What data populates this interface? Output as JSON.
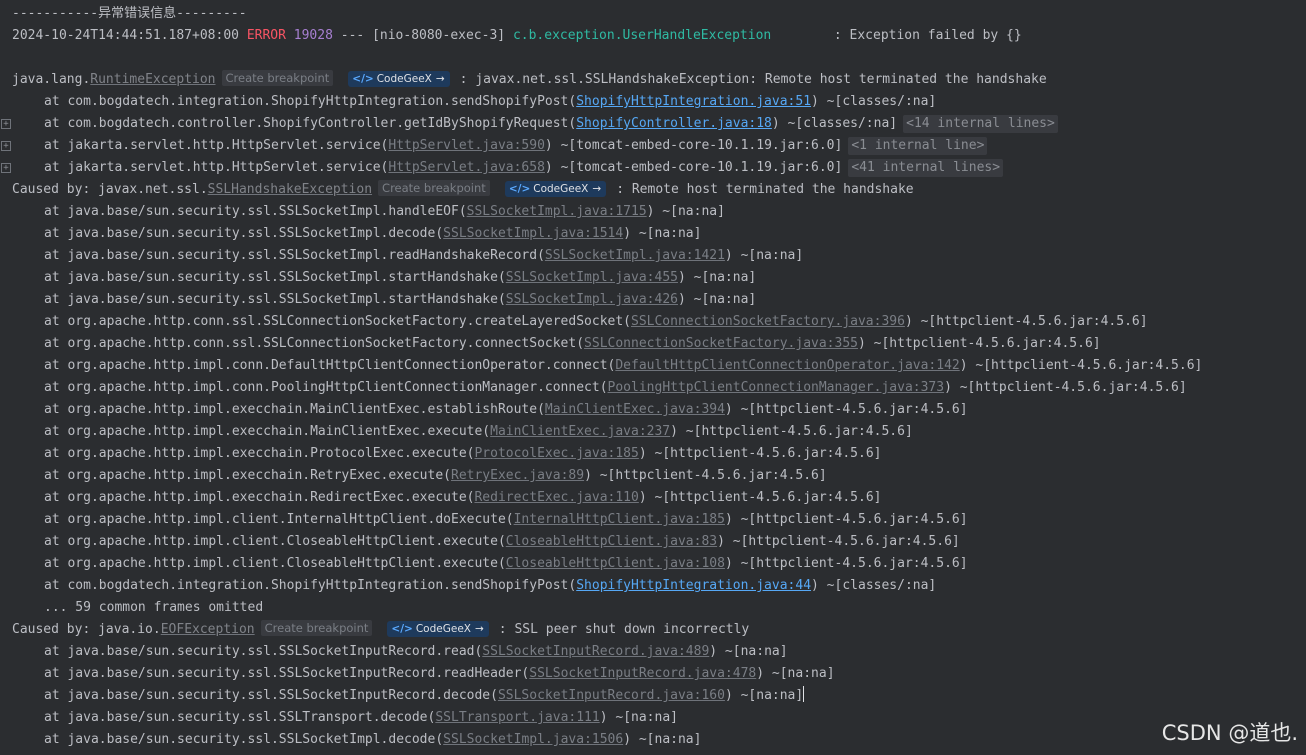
{
  "header_line": "-----------异常错误信息---------",
  "log_line": {
    "timestamp": "2024-10-24T14:44:51.187+08:00",
    "level": "ERROR",
    "pid": "19028",
    "sep": "---",
    "thread": "[nio-8080-exec-3]",
    "logger": "c.b.exception.UserHandleException",
    "message": ": Exception failed by {}"
  },
  "badges": {
    "create_breakpoint": "Create breakpoint",
    "codegeex": "CodeGeeX",
    "codegeex_icon": "</>",
    "codegeex_arrow": "→"
  },
  "exceptions": [
    {
      "prefix": "java.lang.",
      "name": "RuntimeException",
      "message": ": javax.net.ssl.SSLHandshakeException: Remote host terminated the handshake",
      "frames": [
        {
          "method": "at com.bogdatech.integration.ShopifyHttpIntegration.sendShopifyPost(",
          "file": "ShopifyHttpIntegration.java:51",
          "after": ") ~[classes/:na]",
          "lib": false,
          "internal": "",
          "fold": false
        },
        {
          "method": "at com.bogdatech.controller.ShopifyController.getIdByShopifyRequest(",
          "file": "ShopifyController.java:18",
          "after": ") ~[classes/:na]",
          "lib": false,
          "internal": "<14 internal lines>",
          "fold": true
        },
        {
          "method": "at jakarta.servlet.http.HttpServlet.service(",
          "file": "HttpServlet.java:590",
          "after": ") ~[tomcat-embed-core-10.1.19.jar:6.0]",
          "lib": true,
          "internal": "<1 internal line>",
          "fold": true
        },
        {
          "method": "at jakarta.servlet.http.HttpServlet.service(",
          "file": "HttpServlet.java:658",
          "after": ") ~[tomcat-embed-core-10.1.19.jar:6.0]",
          "lib": true,
          "internal": "<41 internal lines>",
          "fold": true
        }
      ],
      "omitted": ""
    },
    {
      "prefix": "Caused by: javax.net.ssl.",
      "name": "SSLHandshakeException",
      "message": ": Remote host terminated the handshake",
      "frames": [
        {
          "method": "at java.base/sun.security.ssl.SSLSocketImpl.handleEOF(",
          "file": "SSLSocketImpl.java:1715",
          "after": ") ~[na:na]",
          "lib": true,
          "internal": "",
          "fold": false
        },
        {
          "method": "at java.base/sun.security.ssl.SSLSocketImpl.decode(",
          "file": "SSLSocketImpl.java:1514",
          "after": ") ~[na:na]",
          "lib": true,
          "internal": "",
          "fold": false
        },
        {
          "method": "at java.base/sun.security.ssl.SSLSocketImpl.readHandshakeRecord(",
          "file": "SSLSocketImpl.java:1421",
          "after": ") ~[na:na]",
          "lib": true,
          "internal": "",
          "fold": false
        },
        {
          "method": "at java.base/sun.security.ssl.SSLSocketImpl.startHandshake(",
          "file": "SSLSocketImpl.java:455",
          "after": ") ~[na:na]",
          "lib": true,
          "internal": "",
          "fold": false
        },
        {
          "method": "at java.base/sun.security.ssl.SSLSocketImpl.startHandshake(",
          "file": "SSLSocketImpl.java:426",
          "after": ") ~[na:na]",
          "lib": true,
          "internal": "",
          "fold": false
        },
        {
          "method": "at org.apache.http.conn.ssl.SSLConnectionSocketFactory.createLayeredSocket(",
          "file": "SSLConnectionSocketFactory.java:396",
          "after": ") ~[httpclient-4.5.6.jar:4.5.6]",
          "lib": true,
          "internal": "",
          "fold": false
        },
        {
          "method": "at org.apache.http.conn.ssl.SSLConnectionSocketFactory.connectSocket(",
          "file": "SSLConnectionSocketFactory.java:355",
          "after": ") ~[httpclient-4.5.6.jar:4.5.6]",
          "lib": true,
          "internal": "",
          "fold": false
        },
        {
          "method": "at org.apache.http.impl.conn.DefaultHttpClientConnectionOperator.connect(",
          "file": "DefaultHttpClientConnectionOperator.java:142",
          "after": ") ~[httpclient-4.5.6.jar:4.5.6]",
          "lib": true,
          "internal": "",
          "fold": false
        },
        {
          "method": "at org.apache.http.impl.conn.PoolingHttpClientConnectionManager.connect(",
          "file": "PoolingHttpClientConnectionManager.java:373",
          "after": ") ~[httpclient-4.5.6.jar:4.5.6]",
          "lib": true,
          "internal": "",
          "fold": false
        },
        {
          "method": "at org.apache.http.impl.execchain.MainClientExec.establishRoute(",
          "file": "MainClientExec.java:394",
          "after": ") ~[httpclient-4.5.6.jar:4.5.6]",
          "lib": true,
          "internal": "",
          "fold": false
        },
        {
          "method": "at org.apache.http.impl.execchain.MainClientExec.execute(",
          "file": "MainClientExec.java:237",
          "after": ") ~[httpclient-4.5.6.jar:4.5.6]",
          "lib": true,
          "internal": "",
          "fold": false
        },
        {
          "method": "at org.apache.http.impl.execchain.ProtocolExec.execute(",
          "file": "ProtocolExec.java:185",
          "after": ") ~[httpclient-4.5.6.jar:4.5.6]",
          "lib": true,
          "internal": "",
          "fold": false
        },
        {
          "method": "at org.apache.http.impl.execchain.RetryExec.execute(",
          "file": "RetryExec.java:89",
          "after": ") ~[httpclient-4.5.6.jar:4.5.6]",
          "lib": true,
          "internal": "",
          "fold": false
        },
        {
          "method": "at org.apache.http.impl.execchain.RedirectExec.execute(",
          "file": "RedirectExec.java:110",
          "after": ") ~[httpclient-4.5.6.jar:4.5.6]",
          "lib": true,
          "internal": "",
          "fold": false
        },
        {
          "method": "at org.apache.http.impl.client.InternalHttpClient.doExecute(",
          "file": "InternalHttpClient.java:185",
          "after": ") ~[httpclient-4.5.6.jar:4.5.6]",
          "lib": true,
          "internal": "",
          "fold": false
        },
        {
          "method": "at org.apache.http.impl.client.CloseableHttpClient.execute(",
          "file": "CloseableHttpClient.java:83",
          "after": ") ~[httpclient-4.5.6.jar:4.5.6]",
          "lib": true,
          "internal": "",
          "fold": false
        },
        {
          "method": "at org.apache.http.impl.client.CloseableHttpClient.execute(",
          "file": "CloseableHttpClient.java:108",
          "after": ") ~[httpclient-4.5.6.jar:4.5.6]",
          "lib": true,
          "internal": "",
          "fold": false
        },
        {
          "method": "at com.bogdatech.integration.ShopifyHttpIntegration.sendShopifyPost(",
          "file": "ShopifyHttpIntegration.java:44",
          "after": ") ~[classes/:na]",
          "lib": false,
          "internal": "",
          "fold": false
        }
      ],
      "omitted": "... 59 common frames omitted"
    },
    {
      "prefix": "Caused by: java.io.",
      "name": "EOFException",
      "message": ": SSL peer shut down incorrectly",
      "frames": [
        {
          "method": "at java.base/sun.security.ssl.SSLSocketInputRecord.read(",
          "file": "SSLSocketInputRecord.java:489",
          "after": ") ~[na:na]",
          "lib": true,
          "internal": "",
          "fold": false
        },
        {
          "method": "at java.base/sun.security.ssl.SSLSocketInputRecord.readHeader(",
          "file": "SSLSocketInputRecord.java:478",
          "after": ") ~[na:na]",
          "lib": true,
          "internal": "",
          "fold": false
        },
        {
          "method": "at java.base/sun.security.ssl.SSLSocketInputRecord.decode(",
          "file": "SSLSocketInputRecord.java:160",
          "after": ") ~[na:na]",
          "lib": true,
          "internal": "",
          "fold": false,
          "cursor": true
        },
        {
          "method": "at java.base/sun.security.ssl.SSLTransport.decode(",
          "file": "SSLTransport.java:111",
          "after": ") ~[na:na]",
          "lib": true,
          "internal": "",
          "fold": false
        },
        {
          "method": "at java.base/sun.security.ssl.SSLSocketImpl.decode(",
          "file": "SSLSocketImpl.java:1506",
          "after": ") ~[na:na]",
          "lib": true,
          "internal": "",
          "fold": false
        }
      ],
      "omitted": ""
    }
  ],
  "fold_icon": "+",
  "watermark": "CSDN @道也."
}
